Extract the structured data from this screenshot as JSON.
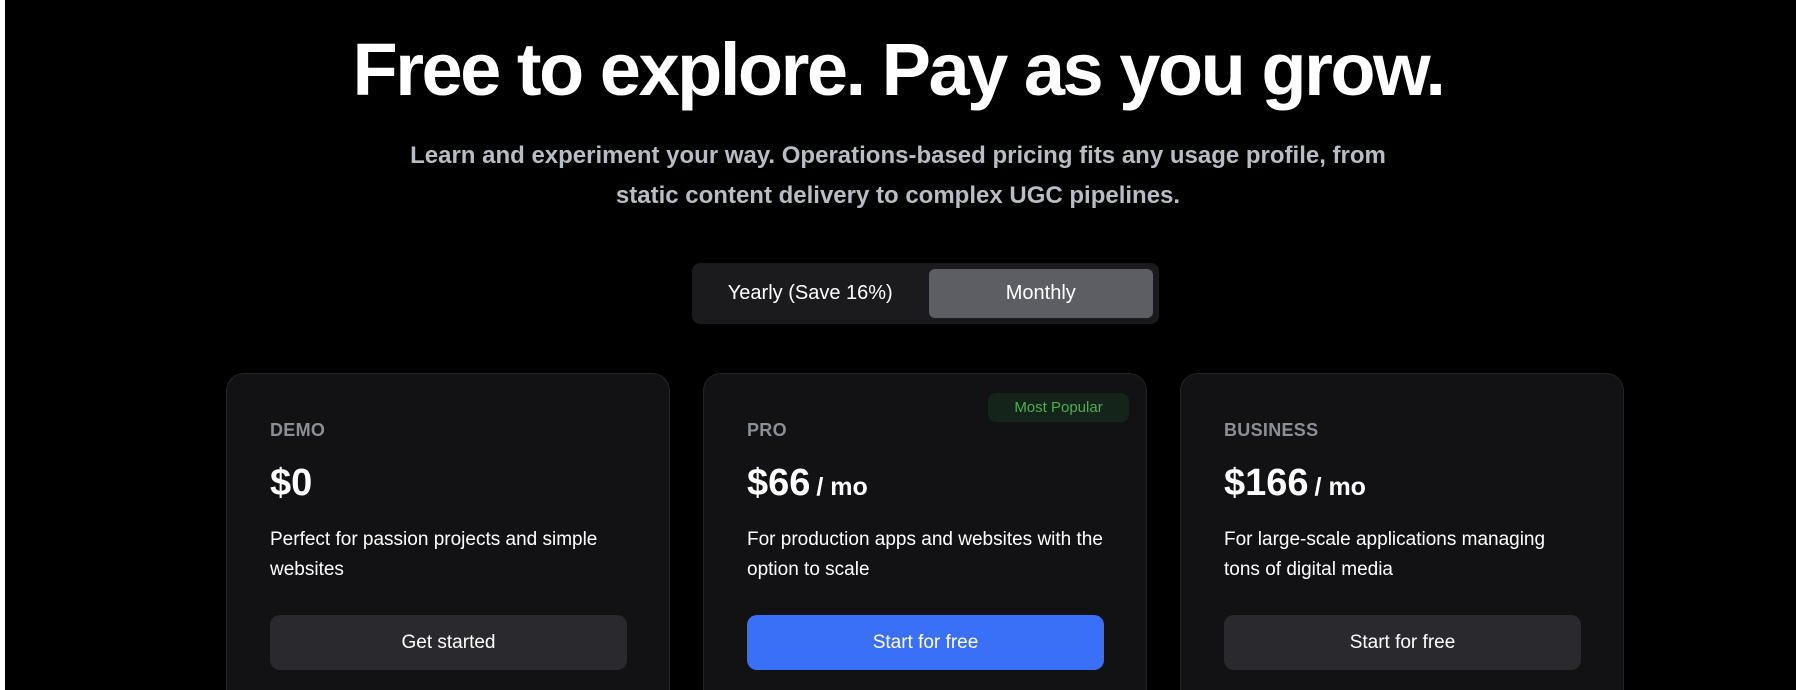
{
  "hero": {
    "headline": "Free to explore. Pay as you grow.",
    "subtitle": "Learn and experiment your way. Operations-based pricing fits any usage profile, from static content delivery to complex UGC pipelines."
  },
  "billing_toggle": {
    "options": [
      {
        "label": "Yearly (Save 16%)",
        "active": false
      },
      {
        "label": "Monthly",
        "active": true
      }
    ]
  },
  "plans": [
    {
      "tier": "DEMO",
      "price": "$0",
      "period": "",
      "description": "Perfect for passion projects and simple websites",
      "cta": "Get started",
      "badge": ""
    },
    {
      "tier": "PRO",
      "price": "$66",
      "period": "/ mo",
      "description": "For production apps and websites with the option to scale",
      "cta": "Start for free",
      "badge": "Most Popular"
    },
    {
      "tier": "BUSINESS",
      "price": "$166",
      "period": "/ mo",
      "description": "For large-scale applications managing tons of digital media",
      "cta": "Start for free",
      "badge": ""
    }
  ],
  "colors": {
    "background": "#000000",
    "card": "#121214",
    "primary_button": "#3a6ff8",
    "secondary_button": "#2a2a2e",
    "badge_text": "#4caf50",
    "toggle_active": "#5d5e63"
  }
}
